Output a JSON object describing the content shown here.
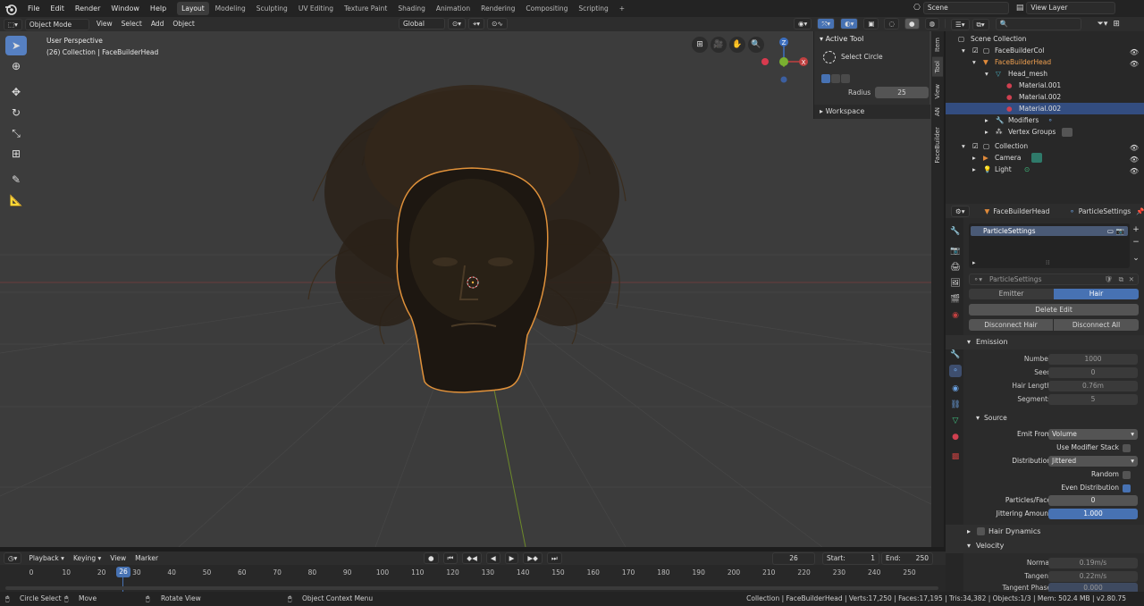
{
  "topbar": {
    "menus": [
      "File",
      "Edit",
      "Render",
      "Window",
      "Help"
    ],
    "workspaces": [
      "Layout",
      "Modeling",
      "Sculpting",
      "UV Editing",
      "Texture Paint",
      "Shading",
      "Animation",
      "Rendering",
      "Compositing",
      "Scripting"
    ],
    "active_workspace": "Layout",
    "add_tab": "+",
    "scene": "Scene",
    "view_layer": "View Layer"
  },
  "viewport_header": {
    "mode": "Object Mode",
    "menus": [
      "View",
      "Select",
      "Add",
      "Object"
    ],
    "orientation": "Global"
  },
  "viewport": {
    "overlay_title": "User Perspective",
    "overlay_subtitle": "(26) Collection | FaceBuilderHead",
    "gizmo": {
      "z": "Z",
      "x": "X"
    }
  },
  "npanel": {
    "active_tool_header": "Active Tool",
    "tool_name": "Select Circle",
    "radius_label": "Radius",
    "radius_value": "25",
    "workspace_header": "Workspace",
    "tabs": [
      "Item",
      "Tool",
      "View",
      "AN",
      "FaceBuilder"
    ]
  },
  "outliner": {
    "rows": [
      {
        "label": "Scene Collection",
        "indent": 0
      },
      {
        "label": "FaceBuilderCol",
        "indent": 1
      },
      {
        "label": "FaceBuilderHead",
        "indent": 2
      },
      {
        "label": "Head_mesh",
        "indent": 3
      },
      {
        "label": "Material.001",
        "indent": 4
      },
      {
        "label": "Material.002",
        "indent": 4
      },
      {
        "label": "Material.002",
        "indent": 4
      },
      {
        "label": "Modifiers",
        "indent": 3
      },
      {
        "label": "Vertex Groups",
        "indent": 3
      },
      {
        "label": "Collection",
        "indent": 1
      },
      {
        "label": "Camera",
        "indent": 2
      },
      {
        "label": "Light",
        "indent": 2
      }
    ]
  },
  "properties": {
    "object_name": "FaceBuilderHead",
    "particle_name": "ParticleSettings",
    "list_item": "ParticleSettings",
    "settings_field": "ParticleSettings",
    "emitter": "Emitter",
    "hair": "Hair",
    "delete_edit": "Delete Edit",
    "disconnect_hair": "Disconnect Hair",
    "disconnect_all": "Disconnect All",
    "emission": {
      "header": "Emission",
      "number_label": "Number",
      "number": "1000",
      "seed_label": "Seed",
      "seed": "0",
      "hair_length_label": "Hair Length",
      "hair_length": "0.76m",
      "segments_label": "Segments",
      "segments": "5"
    },
    "source": {
      "header": "Source",
      "emit_from_label": "Emit From",
      "emit_from": "Volume",
      "use_modifier_stack": "Use Modifier Stack",
      "distribution_label": "Distribution",
      "distribution": "Jittered",
      "random": "Random",
      "even_distribution": "Even Distribution",
      "particles_face_label": "Particles/Face",
      "particles_face": "0",
      "jittering_label": "Jittering Amount",
      "jittering": "1.000"
    },
    "hair_dynamics": "Hair Dynamics",
    "velocity": {
      "header": "Velocity",
      "normal_label": "Normal",
      "normal": "0.19m/s",
      "tangent_label": "Tangent",
      "tangent": "0.22m/s",
      "tangent_phase_label": "Tangent Phase",
      "tangent_phase": "0.000"
    }
  },
  "timeline": {
    "menus": [
      "Playback",
      "Keying",
      "View",
      "Marker"
    ],
    "current_frame": "26",
    "start_label": "Start:",
    "start": "1",
    "end_label": "End:",
    "end": "250",
    "ticks": [
      "0",
      "10",
      "20",
      "30",
      "40",
      "50",
      "60",
      "70",
      "80",
      "90",
      "100",
      "110",
      "120",
      "130",
      "140",
      "150",
      "160",
      "170",
      "180",
      "190",
      "200",
      "210",
      "220",
      "230",
      "240",
      "250"
    ],
    "playhead": "26"
  },
  "status": {
    "circle_select": "Circle Select",
    "move": "Move",
    "rotate_view": "Rotate View",
    "context_menu": "Object Context Menu",
    "stats": "Collection | FaceBuilderHead | Verts:17,250 | Faces:17,195 | Tris:34,382 | Objects:1/3 | Mem: 502.4 MB | v2.80.75"
  }
}
